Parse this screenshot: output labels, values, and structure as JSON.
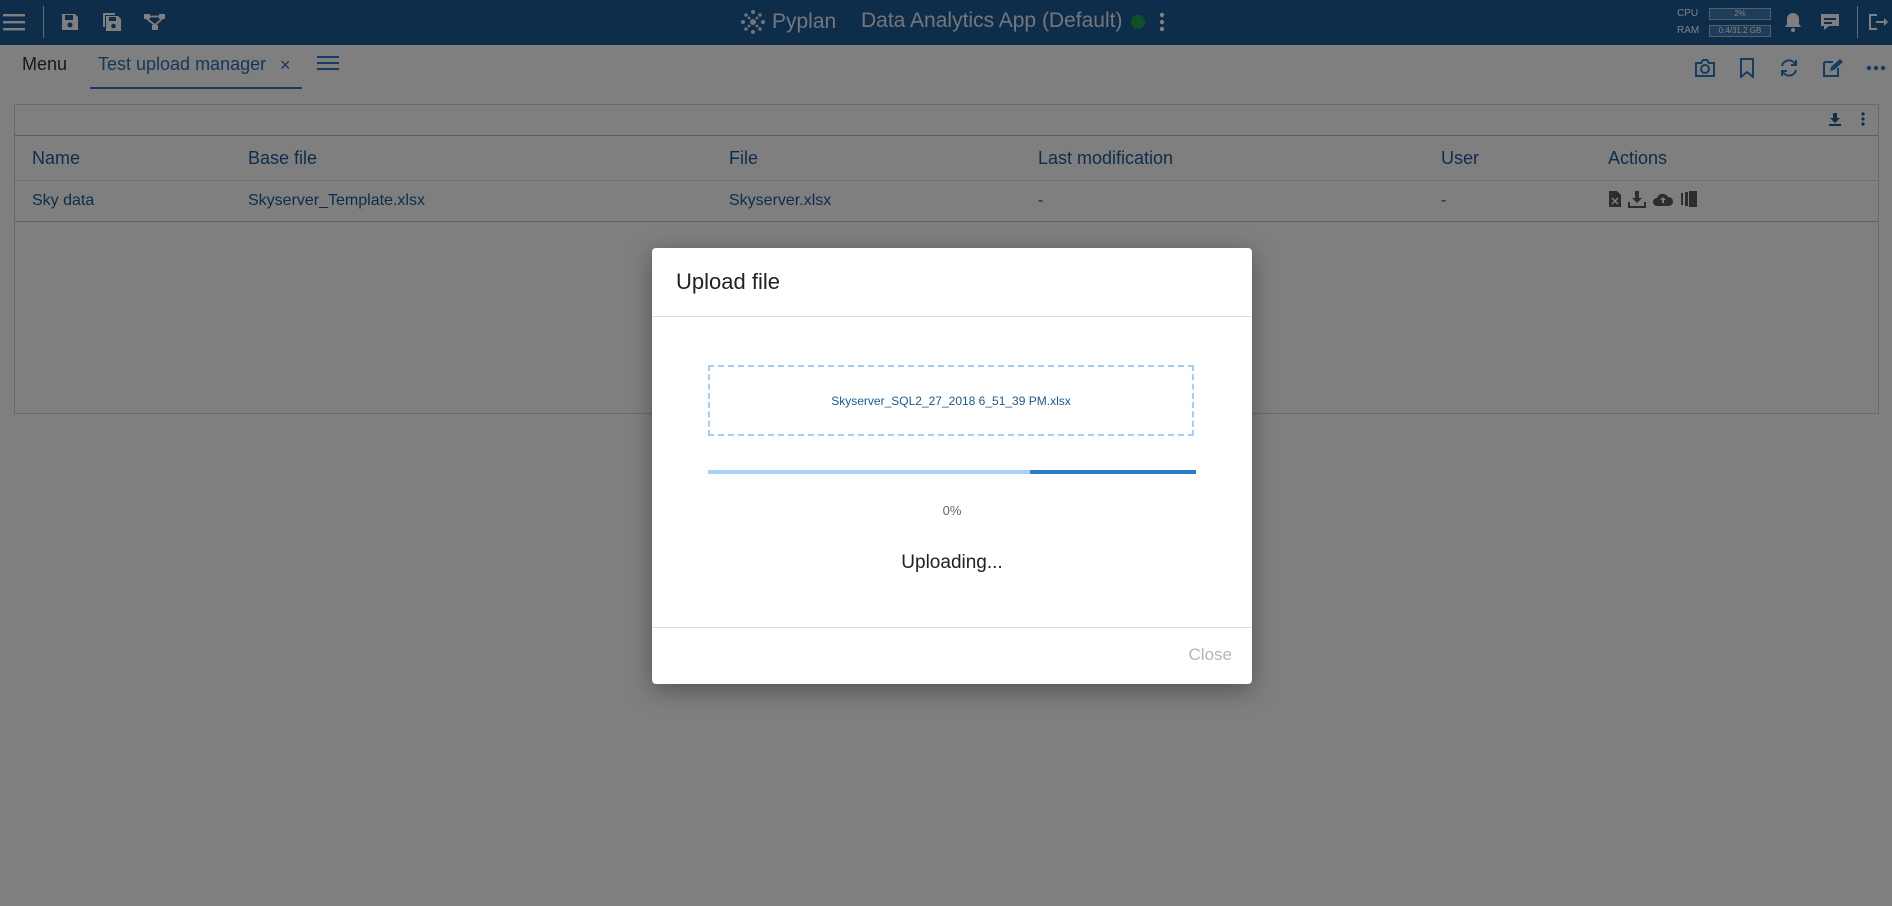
{
  "topbar": {
    "brand": "Pyplan",
    "app_title": "Data Analytics App (Default)",
    "cpu_label": "CPU",
    "cpu_value": "2%",
    "ram_label": "RAM",
    "ram_value": "0.4/31.2 GB",
    "icons": [
      "hamburger-menu-icon",
      "save-icon",
      "save-all-icon",
      "diagram-icon",
      "kebab-icon",
      "bell-icon",
      "chat-icon",
      "logout-icon"
    ]
  },
  "tabs": {
    "menu": "Menu",
    "active": "Test upload manager",
    "close": "×"
  },
  "table": {
    "headers": [
      "Name",
      "Base file",
      "File",
      "Last modification",
      "User",
      "Actions"
    ],
    "rows": [
      {
        "name": "Sky data",
        "base_file": "Skyserver_Template.xlsx",
        "file": "Skyserver.xlsx",
        "last_modification": "-",
        "user": "-"
      }
    ]
  },
  "dialog": {
    "title": "Upload file",
    "file_name": "Skyserver_SQL2_27_2018 6_51_39 PM.xlsx",
    "progress_percent": 0,
    "percent_text": "0%",
    "status": "Uploading...",
    "close_label": "Close"
  },
  "colors": {
    "topbar": "#1d5a94",
    "accent": "#2a7bc8",
    "status_ok": "#1fa24a"
  }
}
